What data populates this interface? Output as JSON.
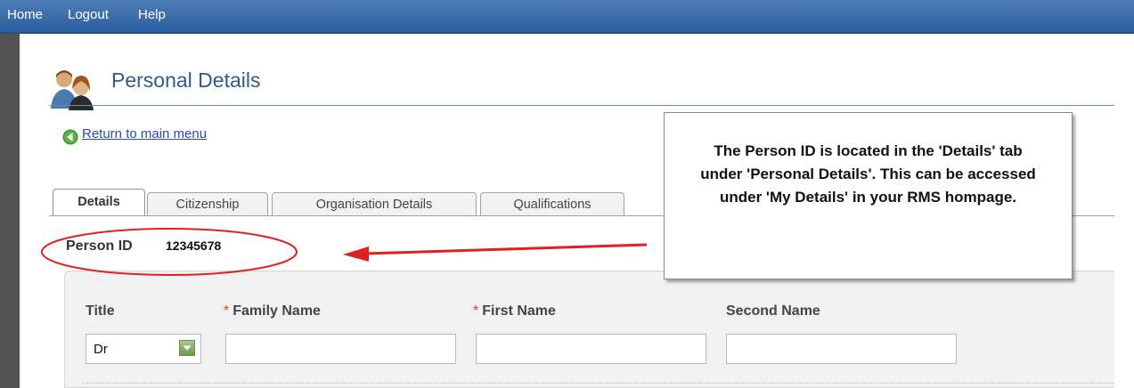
{
  "nav": {
    "items": [
      "Home",
      "Logout",
      "Help"
    ]
  },
  "page": {
    "title": "Personal Details",
    "icon": "people-icon",
    "back_link": "Return to main menu",
    "back_icon": "back-arrow-icon"
  },
  "tabs": [
    {
      "label": "Details",
      "active": true
    },
    {
      "label": "Citizenship",
      "active": false
    },
    {
      "label": "Organisation Details",
      "active": false
    },
    {
      "label": "Qualifications",
      "active": false
    }
  ],
  "person": {
    "id_label": "Person ID",
    "id_value": "12345678"
  },
  "form": {
    "title_label": "Title",
    "title_value": "Dr",
    "family_name_label": "Family Name",
    "first_name_label": "First Name",
    "second_name_label": "Second Name",
    "required_marker": "*"
  },
  "callout": {
    "text": "The Person ID is located in the 'Details' tab under 'Personal Details'. This can be accessed under 'My Details' in your RMS hompage."
  },
  "colors": {
    "nav_bar": "#2c5fa0",
    "title": "#2e5a8c",
    "link": "#2a48c0",
    "required": "#e03a2a",
    "annotation": "#e02020"
  }
}
